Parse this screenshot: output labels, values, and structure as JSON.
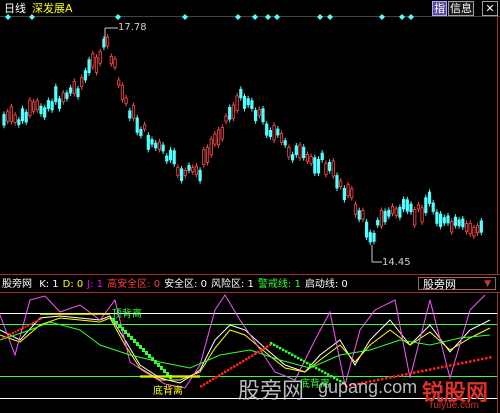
{
  "header": {
    "period": "日线",
    "stock_name": "深发展A",
    "buttons": [
      "指",
      "信息"
    ],
    "close_icon": "close-icon",
    "colors": {
      "period": "#ffffff",
      "stock": "#ffff00"
    }
  },
  "price_chart": {
    "high_label": "17.78",
    "low_label": "14.45"
  },
  "indicator": {
    "name": "股旁网",
    "items": [
      {
        "label": "K:",
        "value": "1",
        "color": "#ffffff"
      },
      {
        "label": "D:",
        "value": "0",
        "color": "#ffff00"
      },
      {
        "label": "J:",
        "value": "1",
        "color": "#ff00ff"
      },
      {
        "label": "高安全区:",
        "value": "0",
        "color": "#ff3b3b"
      },
      {
        "label": "安全区:",
        "value": "0",
        "color": "#ffffff"
      },
      {
        "label": "风险区:",
        "value": "1",
        "color": "#ffffff"
      },
      {
        "label": "警戒线:",
        "value": "1",
        "color": "#33ff33"
      },
      {
        "label": "启动线:",
        "value": "0",
        "color": "#ffffff"
      }
    ],
    "dropdown_value": "股旁网",
    "annotations": {
      "top_divergence": "顶背离",
      "bottom_divergence": "底背离"
    }
  },
  "watermark": {
    "main": "股旁网",
    "site": "gupang.com",
    "brand": "锐股网",
    "brand_url": "ruiyue.com"
  }
}
